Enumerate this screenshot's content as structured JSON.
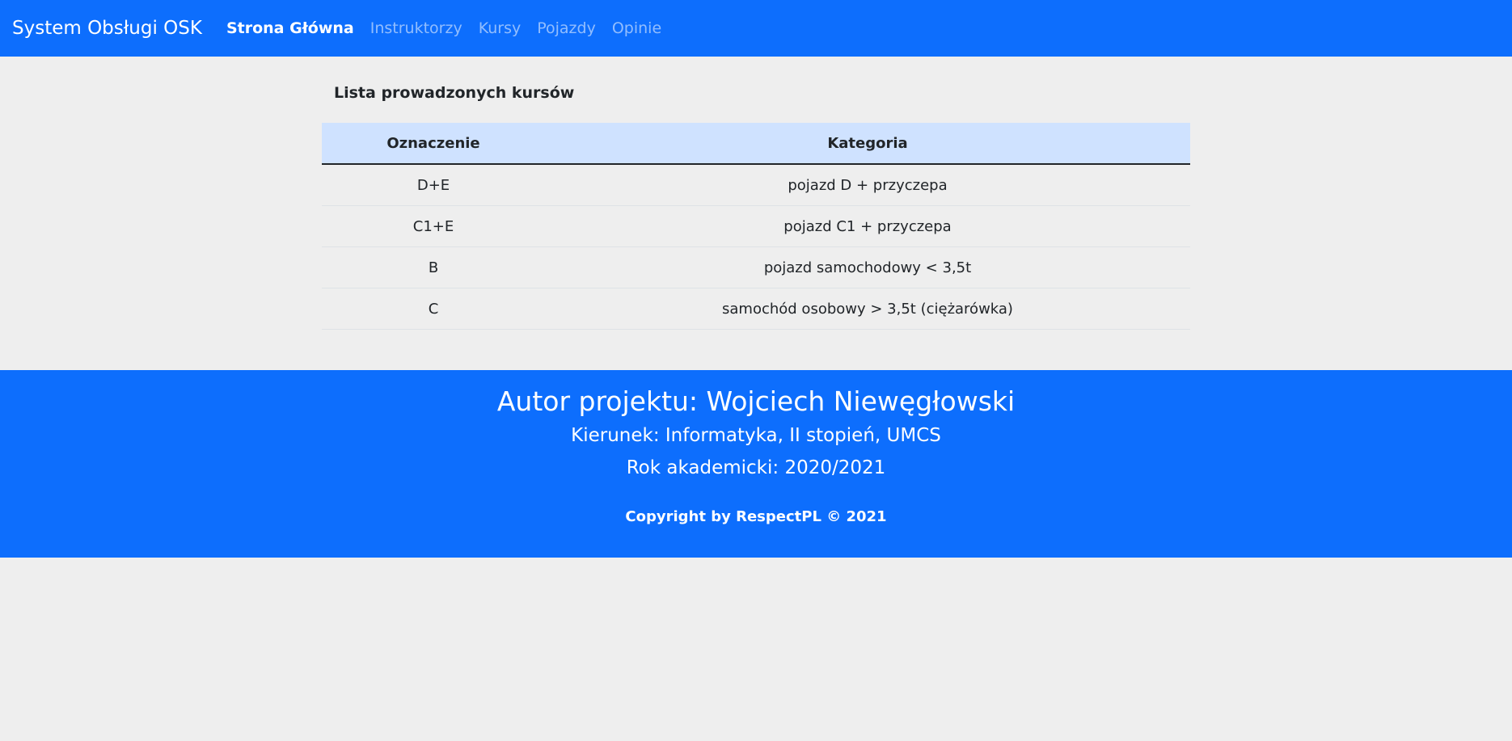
{
  "nav": {
    "brand": "System Obsługi OSK",
    "links": [
      {
        "label": "Strona Główna",
        "active": true
      },
      {
        "label": "Instruktorzy",
        "active": false
      },
      {
        "label": "Kursy",
        "active": false
      },
      {
        "label": "Pojazdy",
        "active": false
      },
      {
        "label": "Opinie",
        "active": false
      }
    ]
  },
  "main": {
    "title": "Lista prowadzonych kursów",
    "table": {
      "headers": [
        "Oznaczenie",
        "Kategoria"
      ],
      "rows": [
        [
          "D+E",
          "pojazd D + przyczepa"
        ],
        [
          "C1+E",
          "pojazd C1 + przyczepa"
        ],
        [
          "B",
          "pojazd samochodowy < 3,5t"
        ],
        [
          "C",
          "samochód osobowy > 3,5t (ciężarówka)"
        ]
      ]
    }
  },
  "footer": {
    "author": "Autor projektu: Wojciech Niewęgłowski",
    "major": "Kierunek: Informatyka, II stopień, UMCS",
    "year": "Rok akademicki: 2020/2021",
    "copyright": "Copyright by RespectPL © 2021"
  },
  "colors": {
    "primary": "#0d6efd",
    "header_row": "#cfe2ff",
    "background": "#eeeeee"
  }
}
